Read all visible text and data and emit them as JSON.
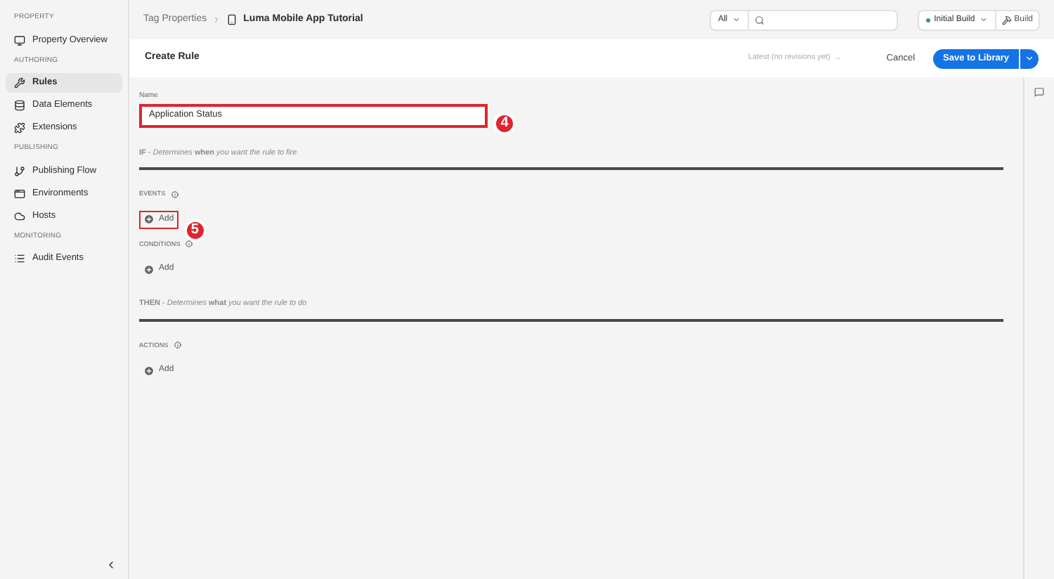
{
  "sidebar": {
    "sections": [
      {
        "heading": "PROPERTY",
        "items": [
          {
            "label": "Property Overview",
            "selected": false
          }
        ]
      },
      {
        "heading": "AUTHORING",
        "items": [
          {
            "label": "Rules",
            "selected": true
          },
          {
            "label": "Data Elements",
            "selected": false
          },
          {
            "label": "Extensions",
            "selected": false
          }
        ]
      },
      {
        "heading": "PUBLISHING",
        "items": [
          {
            "label": "Publishing Flow",
            "selected": false
          },
          {
            "label": "Environments",
            "selected": false
          },
          {
            "label": "Hosts",
            "selected": false
          }
        ]
      },
      {
        "heading": "MONITORING",
        "items": [
          {
            "label": "Audit Events",
            "selected": false
          }
        ]
      }
    ]
  },
  "breadcrumb": {
    "parent": "Tag Properties",
    "current": "Luma Mobile App Tutorial"
  },
  "filter": {
    "value": "All"
  },
  "build": {
    "label": "Initial Build",
    "button": "Build"
  },
  "header": {
    "title": "Create Rule",
    "revision": "Latest (no revisions yet)",
    "cancel": "Cancel",
    "save": "Save to Library"
  },
  "name_field": {
    "label": "Name",
    "value": "Application Status",
    "highlighted": true,
    "callout": "4"
  },
  "blocks": [
    {
      "intro": "**IF** - *Determines* **when** *you want the rule to fire*",
      "groups": [
        {
          "label": "EVENTS",
          "add": "Add",
          "highlighted": true,
          "callout": "5"
        },
        {
          "label": "CONDITIONS",
          "add": "Add",
          "highlighted": false
        }
      ]
    },
    {
      "intro": "**THEN** - *Determines* **what** *you want the rule to do*",
      "groups": [
        {
          "label": "ACTIONS",
          "add": "Add",
          "highlighted": false
        }
      ]
    }
  ]
}
